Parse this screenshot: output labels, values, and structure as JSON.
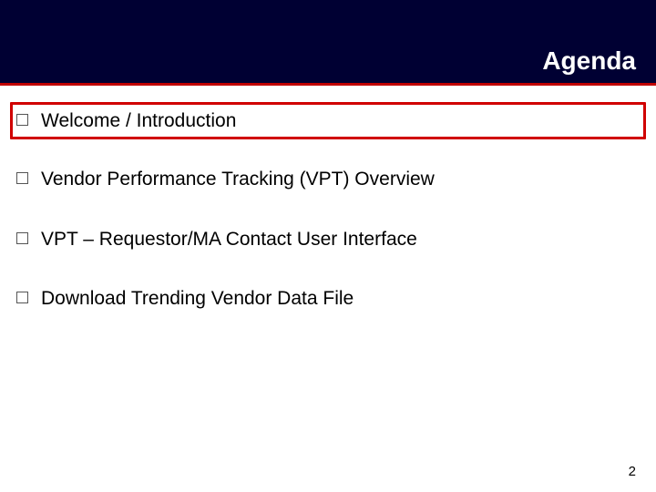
{
  "header": {
    "title": "Agenda"
  },
  "bullets": {
    "items": [
      {
        "text": "Welcome / Introduction",
        "highlighted": true
      },
      {
        "text": "Vendor Performance Tracking (VPT) Overview",
        "highlighted": false
      },
      {
        "text": "VPT – Requestor/MA Contact User Interface",
        "highlighted": false
      },
      {
        "text": "Download Trending Vendor Data File",
        "highlighted": false
      }
    ]
  },
  "page_number": "2"
}
